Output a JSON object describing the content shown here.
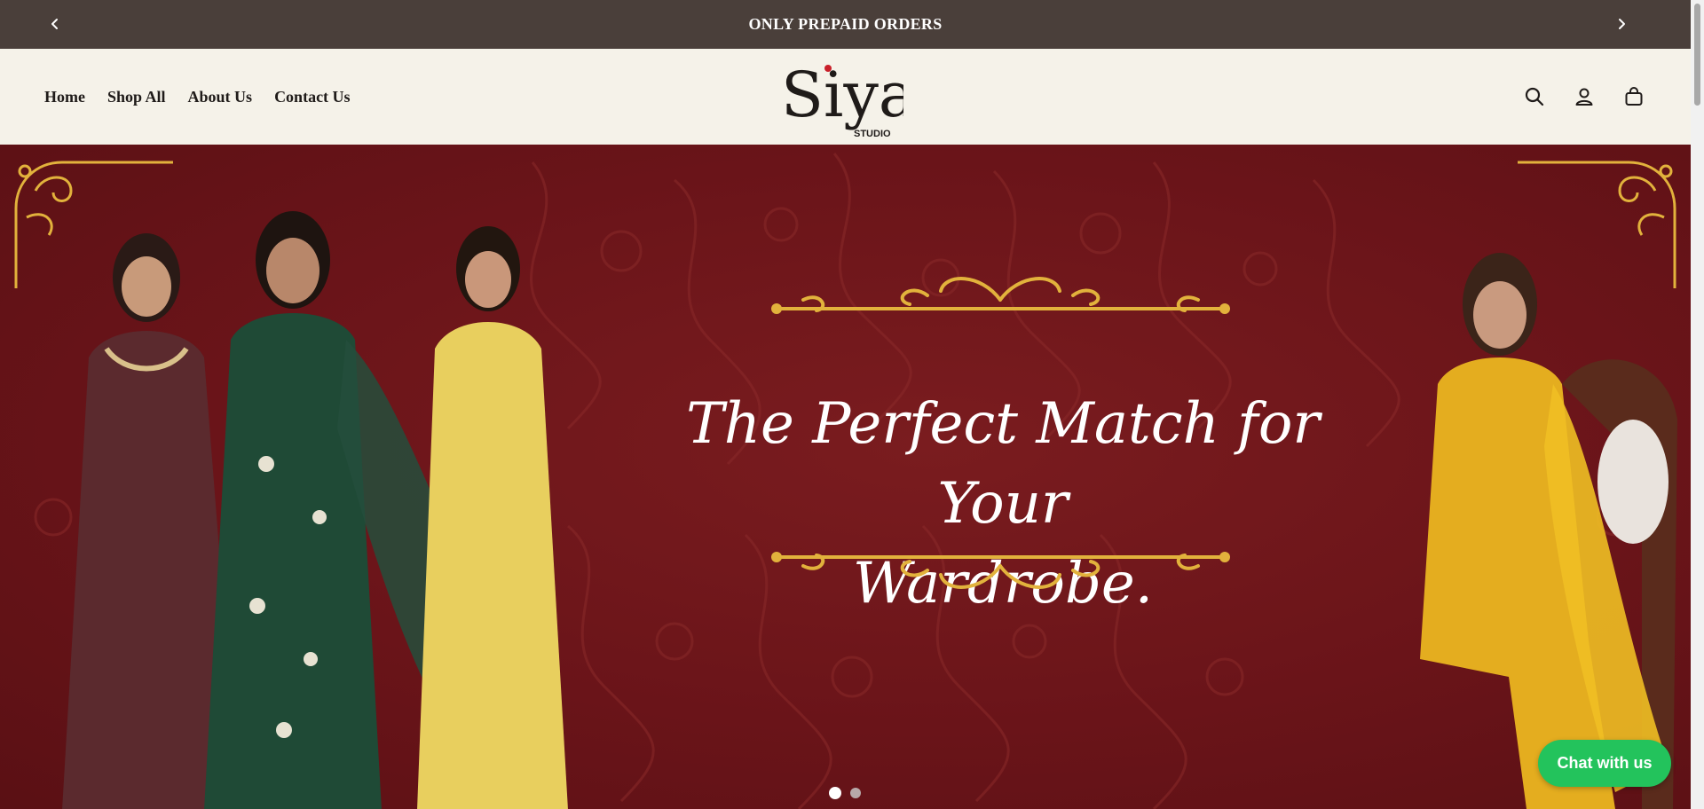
{
  "announcement": {
    "text": "ONLY PREPAID ORDERS",
    "prev_icon": "chevron-left-icon",
    "next_icon": "chevron-right-icon"
  },
  "nav": {
    "items": [
      {
        "label": "Home"
      },
      {
        "label": "Shop All"
      },
      {
        "label": "About Us"
      },
      {
        "label": "Contact Us"
      }
    ]
  },
  "logo": {
    "name": "Siya",
    "sub": "STUDIO"
  },
  "header_icons": [
    "search-icon",
    "account-icon",
    "cart-icon"
  ],
  "hero": {
    "title_line1": "The Perfect Match for Your",
    "title_line2": "Wardrobe.",
    "slides": 2,
    "active_slide": 1
  },
  "chat": {
    "label": "Chat with us"
  },
  "colors": {
    "announcement_bg": "#4a3f3a",
    "header_bg": "#f5f2e9",
    "hero_bg": "#6a1419",
    "gold": "#e2b23c",
    "chat_green": "#23c35c"
  }
}
